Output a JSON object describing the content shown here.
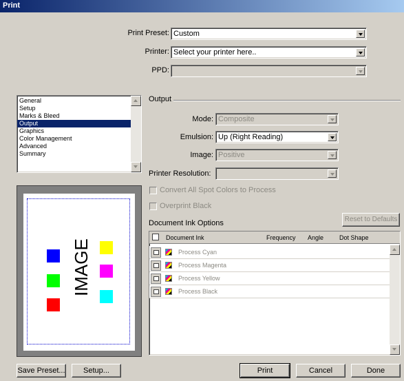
{
  "window": {
    "title": "Print"
  },
  "top_fields": {
    "preset_label": "Print Preset:",
    "preset_value": "Custom",
    "printer_label": "Printer:",
    "printer_value": "Select your printer here..",
    "ppd_label": "PPD:",
    "ppd_value": ""
  },
  "categories": {
    "items": [
      "General",
      "Setup",
      "Marks & Bleed",
      "Output",
      "Graphics",
      "Color Management",
      "Advanced",
      "Summary"
    ],
    "selected": "Output"
  },
  "output": {
    "section_title": "Output",
    "mode_label": "Mode:",
    "mode_value": "Composite",
    "emulsion_label": "Emulsion:",
    "emulsion_value": "Up (Right Reading)",
    "image_label": "Image:",
    "image_value": "Positive",
    "resolution_label": "Printer Resolution:",
    "resolution_value": "",
    "convert_spot_label": "Convert All Spot Colors to Process",
    "convert_spot_checked": false,
    "overprint_label": "Overprint Black",
    "overprint_checked": false
  },
  "ink_options": {
    "title": "Document Ink Options",
    "reset_label": "Reset to Defaults",
    "columns": [
      "Document Ink",
      "Frequency",
      "Angle",
      "Dot Shape"
    ],
    "inks": [
      "Process Cyan",
      "Process Magenta",
      "Process Yellow",
      "Process Black"
    ]
  },
  "preview": {
    "image_text": "IMAGE",
    "swatch_colors": [
      "#0000ff",
      "#00ff00",
      "#ff0000",
      "#ffff00",
      "#ff00ff",
      "#00ffff"
    ]
  },
  "buttons": {
    "save_preset": "Save Preset...",
    "setup": "Setup...",
    "print": "Print",
    "cancel": "Cancel",
    "done": "Done"
  }
}
